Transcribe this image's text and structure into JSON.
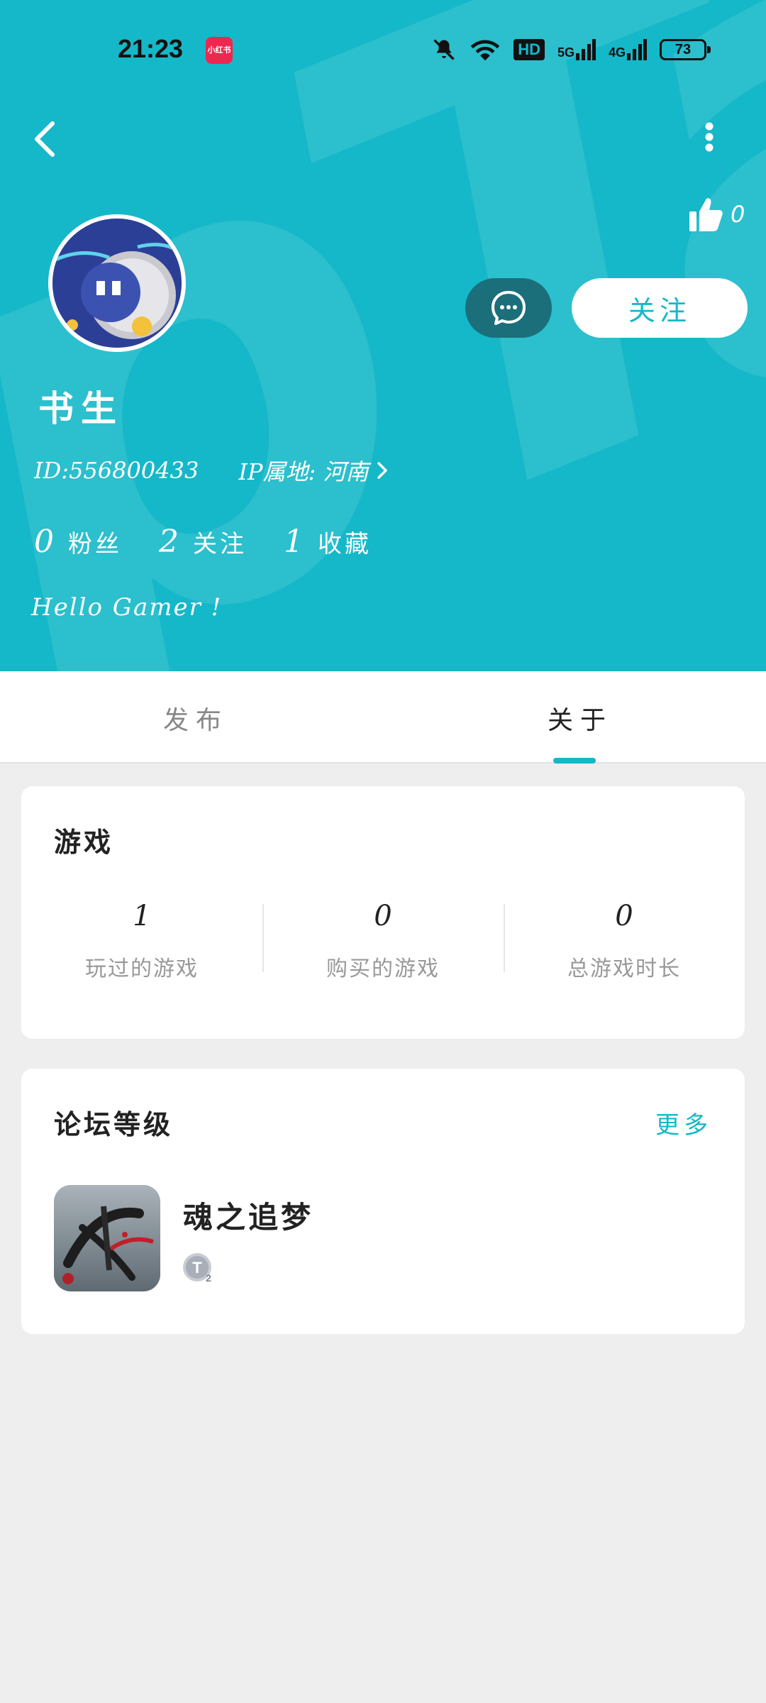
{
  "status_bar": {
    "time": "21:23",
    "app_badge": "小红书",
    "network_hd": "HD",
    "network_5g": "5G",
    "network_4g": "4G",
    "battery": "73"
  },
  "header": {
    "like_count": "0",
    "follow_label": "关注",
    "message_icon": "chat-bubble-icon"
  },
  "profile": {
    "name": "书生",
    "id_text": "ID:556800433",
    "ip_text": "IP属地: 河南",
    "stats": [
      {
        "num": "0",
        "label": "粉丝"
      },
      {
        "num": "2",
        "label": "关注"
      },
      {
        "num": "1",
        "label": "收藏"
      }
    ],
    "bio": "Hello Gamer !"
  },
  "tabs": {
    "publish": "发布",
    "about": "关于",
    "active": "about"
  },
  "games_card": {
    "title": "游戏",
    "stats": [
      {
        "num": "1",
        "label": "玩过的游戏"
      },
      {
        "num": "0",
        "label": "购买的游戏"
      },
      {
        "num": "0",
        "label": "总游戏时长"
      }
    ]
  },
  "forum_card": {
    "title": "论坛等级",
    "more": "更多",
    "game_name": "魂之追梦",
    "level_badge": "T2"
  },
  "colors": {
    "accent": "#15b8c8",
    "message_button": "#1b6f7b",
    "background": "#eeeeee"
  }
}
